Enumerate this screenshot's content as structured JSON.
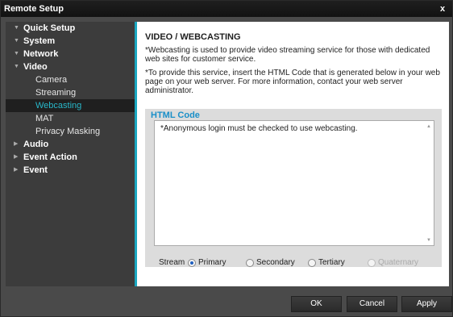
{
  "window": {
    "title": "Remote Setup",
    "close_glyph": "x"
  },
  "sidebar": {
    "items": [
      {
        "label": "Quick Setup",
        "arrow": "▼"
      },
      {
        "label": "System",
        "arrow": "▼"
      },
      {
        "label": "Network",
        "arrow": "▼"
      },
      {
        "label": "Video",
        "arrow": "▼"
      },
      {
        "label": "Audio",
        "arrow": "▶"
      },
      {
        "label": "Event Action",
        "arrow": "▶"
      },
      {
        "label": "Event",
        "arrow": "▶"
      }
    ],
    "video_sub": [
      "Camera",
      "Streaming",
      "Webcasting",
      "MAT",
      "Privacy Masking"
    ],
    "active_sub": "Webcasting"
  },
  "main": {
    "heading": "VIDEO / WEBCASTING",
    "para1": "*Webcasting is used to provide video streaming service for those with dedicated web sites for customer service.",
    "para2": "*To provide this service, insert the HTML Code that is generated  below in your web page on your web server. For more information, contact your web server administrator.",
    "group_title": "HTML Code",
    "code_text": "*Anonymous login must be checked to use webcasting.",
    "stream_label": "Stream",
    "stream_options": [
      "Primary",
      "Secondary",
      "Tertiary",
      "Quaternary"
    ],
    "stream_selected": "Primary"
  },
  "footer": {
    "ok": "OK",
    "cancel": "Cancel",
    "apply": "Apply"
  },
  "colors": {
    "accent": "#1aa7c0",
    "active_text": "#28b7c9",
    "group_title": "#1a8fc8"
  }
}
